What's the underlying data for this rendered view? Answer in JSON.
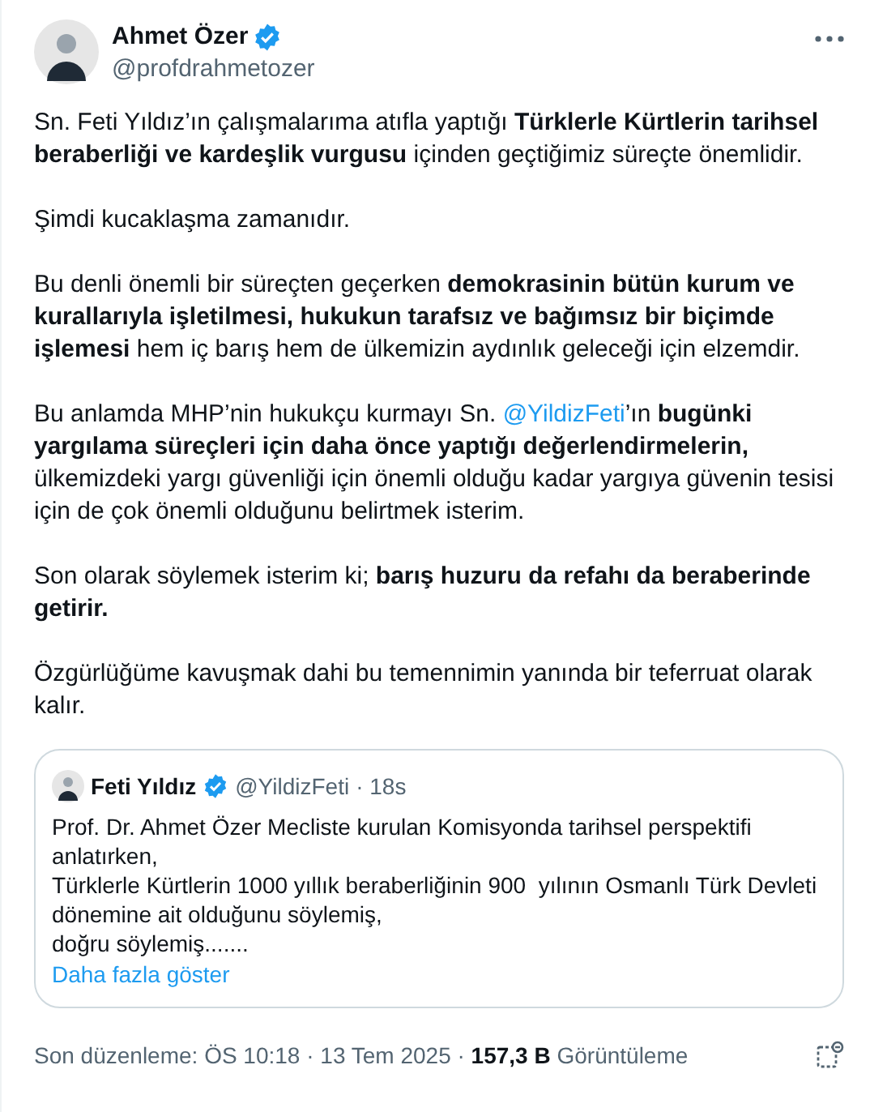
{
  "author": {
    "name": "Ahmet Özer",
    "handle": "@profdrahmetozer",
    "verified": true
  },
  "paragraphs": [
    [
      {
        "kind": "text",
        "text": "Sn. Feti Yıldız’ın çalışmalarıma atıfla yaptığı **Türklerle Kürtlerin tarihsel beraberliği ve kardeşlik vurgusu** içinden geçtiğimiz süreçte önemlidir."
      }
    ],
    [
      {
        "kind": "text",
        "text": "Şimdi kucaklaşma zamanıdır."
      }
    ],
    [
      {
        "kind": "text",
        "text": "Bu denli önemli bir süreçten geçerken **demokrasinin bütün kurum ve kurallarıyla işletilmesi, hukukun tarafsız ve bağımsız bir biçimde işlemesi** hem iç barış hem de ülkemizin aydınlık geleceği için elzemdir."
      }
    ],
    [
      {
        "kind": "text",
        "text": "Bu anlamda MHP’nin hukukçu kurmayı Sn. "
      },
      {
        "kind": "mention",
        "text": "@YildizFeti"
      },
      {
        "kind": "text",
        "text": "’ın **bugünki yargılama süreçleri için daha önce yaptığı değerlendirmelerin,** ülkemizdeki yargı güvenliği için önemli olduğu kadar yargıya güvenin tesisi için de çok önemli olduğunu belirtmek isterim."
      }
    ],
    [
      {
        "kind": "text",
        "text": "Son olarak söylemek isterim ki; **barış huzuru da refahı da beraberinde getirir.**"
      }
    ],
    [
      {
        "kind": "text",
        "text": "Özgürlüğüme kavuşmak dahi bu temennimin yanında bir teferruat olarak kalır."
      }
    ]
  ],
  "quote": {
    "name": "Feti Yıldız",
    "verified": true,
    "handle": "@YildizFeti",
    "time": "· 18s",
    "text": "Prof. Dr. Ahmet Özer Mecliste kurulan Komisyonda tarihsel perspektifi anlatırken,\nTürklerle Kürtlerin 1000 yıllık beraberliğinin 900  yılının Osmanlı Türk Devleti dönemine ait olduğunu söylemiş,\ndoğru söylemiş.......",
    "show_more": "Daha fazla göster"
  },
  "footer": "Son düzenleme: ÖS 10:18 · 13 Tem 2025 · **157,3 B** Görüntüleme"
}
